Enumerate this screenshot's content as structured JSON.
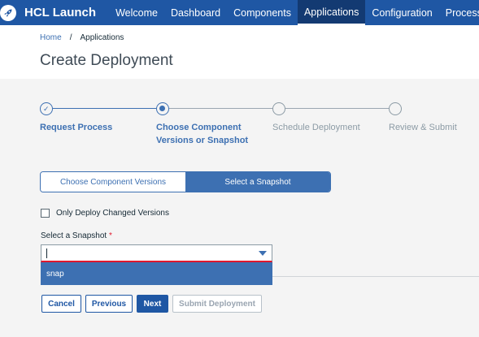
{
  "nav": {
    "brand": "HCL Launch",
    "links": [
      "Welcome",
      "Dashboard",
      "Components",
      "Applications",
      "Configuration",
      "Processes"
    ],
    "active": "Applications",
    "logo_icon": "rocket-icon"
  },
  "breadcrumb": {
    "home": "Home",
    "separator": "/",
    "current": "Applications"
  },
  "page_title": "Create Deployment",
  "steps": [
    {
      "label_line1": "Request Process",
      "label_line2": "",
      "state": "done"
    },
    {
      "label_line1": "Choose Component",
      "label_line2": "Versions or Snapshot",
      "state": "current"
    },
    {
      "label_line1": "Schedule Deployment",
      "label_line2": "",
      "state": "todo"
    },
    {
      "label_line1": "Review & Submit",
      "label_line2": "",
      "state": "todo"
    }
  ],
  "toggle": {
    "left": "Choose Component Versions",
    "right": "Select a Snapshot",
    "selected": "Select a Snapshot"
  },
  "checkbox": {
    "label": "Only Deploy Changed Versions",
    "checked": false
  },
  "snapshot_select": {
    "label": "Select a Snapshot",
    "required_mark": "*",
    "value": "",
    "options": [
      "snap"
    ]
  },
  "buttons": {
    "cancel": "Cancel",
    "previous": "Previous",
    "next": "Next",
    "submit": "Submit Deployment"
  },
  "colors": {
    "nav_bg": "#1f57a4",
    "accent": "#3d70b2",
    "required": "#e0182d"
  }
}
